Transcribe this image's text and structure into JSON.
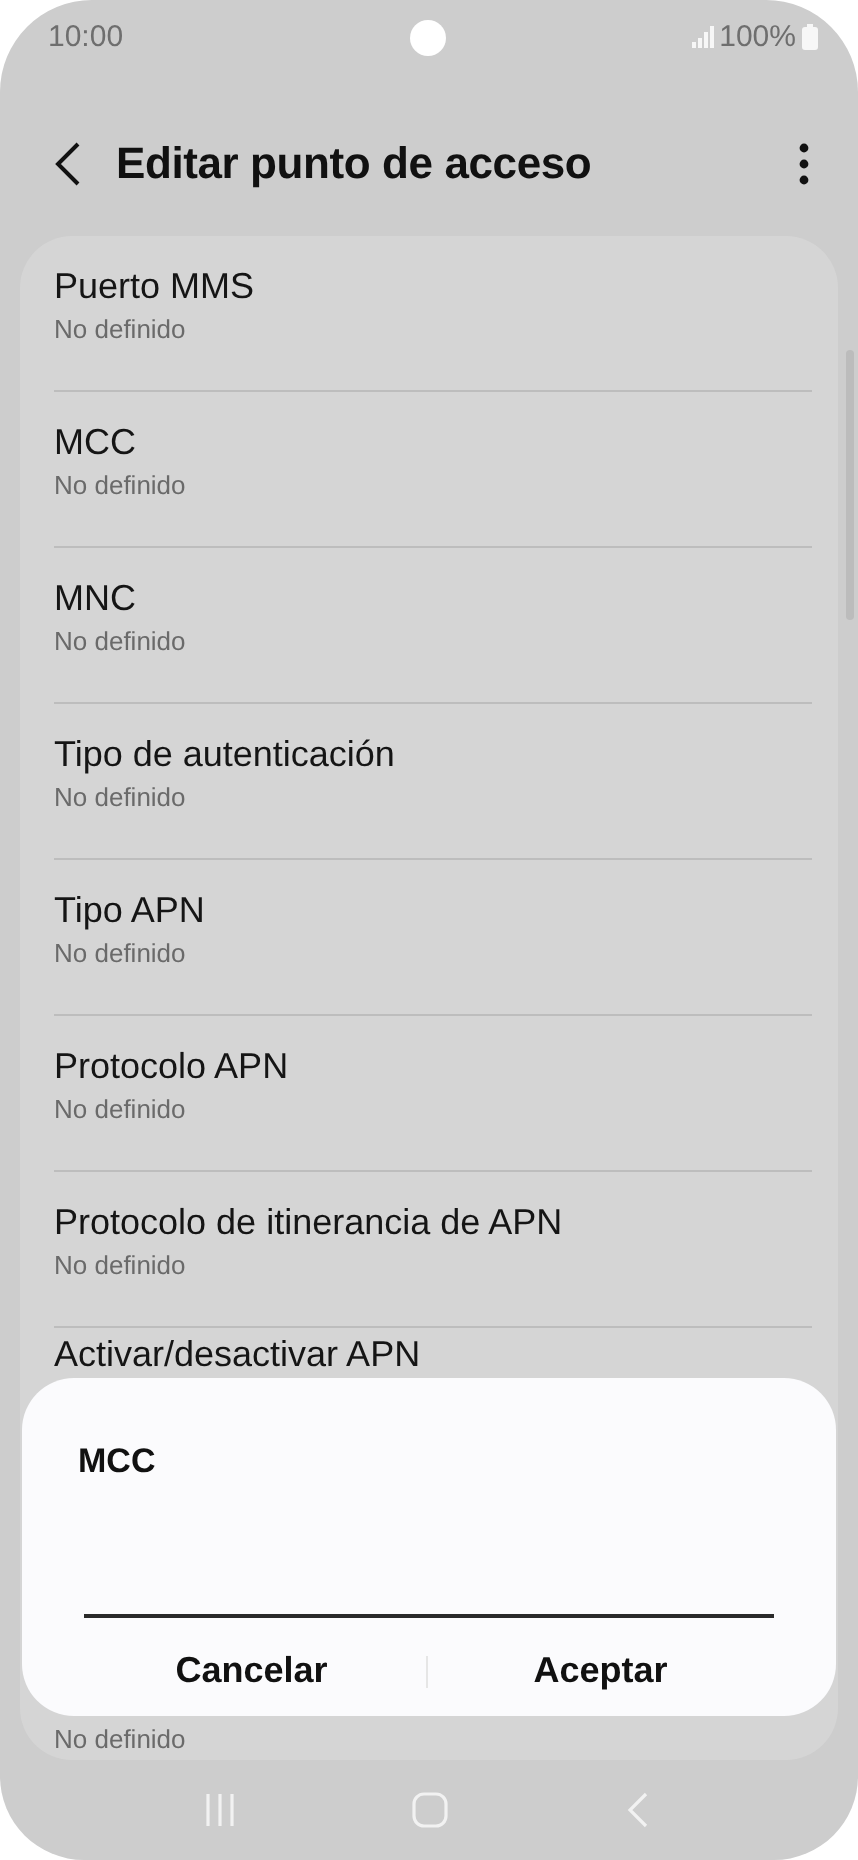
{
  "status_bar": {
    "time": "10:00",
    "battery": "100%"
  },
  "header": {
    "title": "Editar punto de acceso"
  },
  "rows": [
    {
      "title": "Puerto MMS",
      "subtitle": "No definido"
    },
    {
      "title": "MCC",
      "subtitle": "No definido"
    },
    {
      "title": "MNC",
      "subtitle": "No definido"
    },
    {
      "title": "Tipo de autenticación",
      "subtitle": "No definido"
    },
    {
      "title": "Tipo APN",
      "subtitle": "No definido"
    },
    {
      "title": "Protocolo APN",
      "subtitle": "No definido"
    },
    {
      "title": "Protocolo de itinerancia de APN",
      "subtitle": "No definido"
    },
    {
      "title": "Activar/desactivar APN"
    },
    {
      "subtitle": "No definido"
    }
  ],
  "dialog": {
    "title": "MCC",
    "buttons": [
      "Cancelar",
      "Aceptar"
    ]
  }
}
